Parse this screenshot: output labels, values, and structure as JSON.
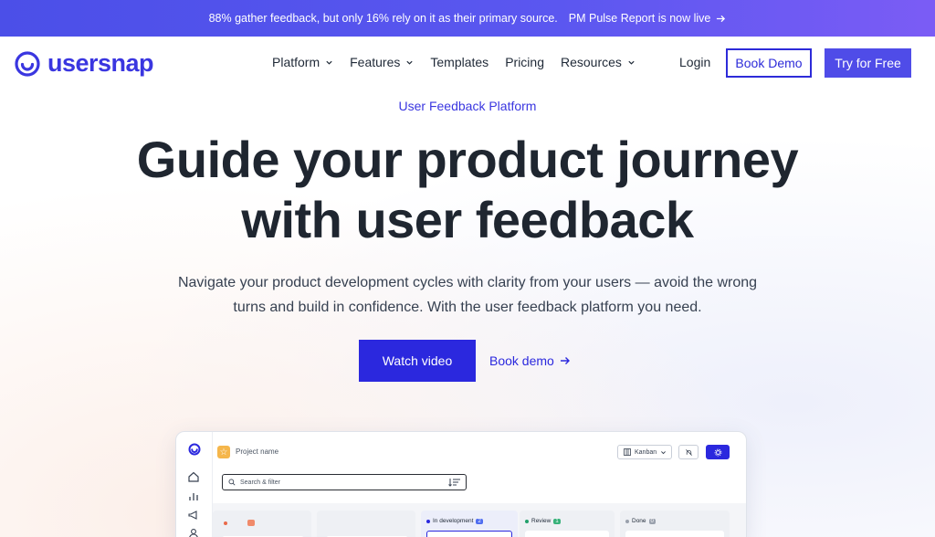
{
  "announcement": {
    "text": "88% gather feedback, but only 16% rely on it as their primary source.",
    "link_label": "PM Pulse Report is now live"
  },
  "nav": {
    "logo_text": "usersnap",
    "menu": [
      {
        "label": "Platform"
      },
      {
        "label": "Features"
      },
      {
        "label": "Templates"
      },
      {
        "label": "Pricing"
      },
      {
        "label": "Resources"
      }
    ],
    "login_label": "Login",
    "book_demo_label": "Book Demo",
    "try_label": "Try for Free"
  },
  "hero": {
    "eyebrow": "User Feedback Platform",
    "headline_line1": "Guide your product journey",
    "headline_line2": "with user feedback",
    "sub_line1": "Navigate your product development cycles with clarity from your users — avoid the wrong",
    "sub_line2": "turns and build in confidence. With the user feedback platform you need.",
    "watch_label": "Watch video",
    "book_link_label": "Book demo"
  },
  "app_preview": {
    "project_name": "Project name",
    "view_select": "Kanban",
    "search_placeholder": "Search & filter",
    "columns": [
      {
        "label": "In development",
        "count": "2"
      },
      {
        "label": "Review",
        "count": "1"
      },
      {
        "label": "Done",
        "count": "0"
      }
    ]
  },
  "colors": {
    "brand": "#3a36e0",
    "primary_button": "#2b28de",
    "try_button": "#4f4ce8",
    "banner_start": "#4b4fe8",
    "banner_end": "#7b5cf5"
  }
}
